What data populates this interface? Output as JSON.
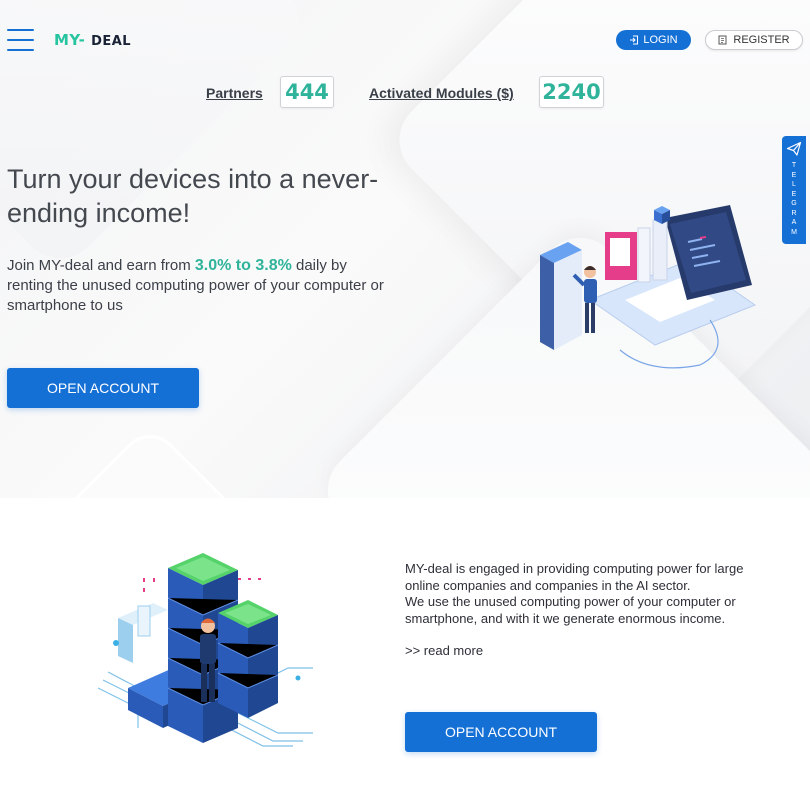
{
  "header": {
    "logo_my": "MY",
    "logo_dash": "-",
    "logo_deal": "DEAL",
    "login_label": "LOGIN",
    "register_label": "REGISTER"
  },
  "stats": {
    "partners_label": "Partners",
    "partners_value": "444",
    "modules_label": "Activated Modules ($)",
    "modules_value": "2240"
  },
  "telegram": {
    "letters": [
      "T",
      "E",
      "L",
      "E",
      "G",
      "R",
      "A",
      "M"
    ]
  },
  "hero": {
    "title": "Turn your devices into a never-ending income!",
    "sub_before": "Join MY-deal and earn from ",
    "sub_highlight": "3.0% to 3.8%",
    "sub_after": " daily by renting the unused computing power of your computer or smartphone to us",
    "button_label": "OPEN ACCOUNT"
  },
  "about": {
    "line1": "MY-deal is engaged in providing computing power for large online companies and companies in the AI sector.",
    "line2": "We use the unused computing power of your computer or smartphone, and with it we generate enormous income.",
    "read_more": ">> read more",
    "button_label": "OPEN ACCOUNT"
  },
  "colors": {
    "primary": "#1570d6",
    "accent": "#2fb39a",
    "logo_green": "#27c4a0"
  },
  "icons": {
    "menu": "hamburger-menu-icon",
    "login": "login-icon",
    "register": "register-icon",
    "telegram": "telegram-icon"
  }
}
